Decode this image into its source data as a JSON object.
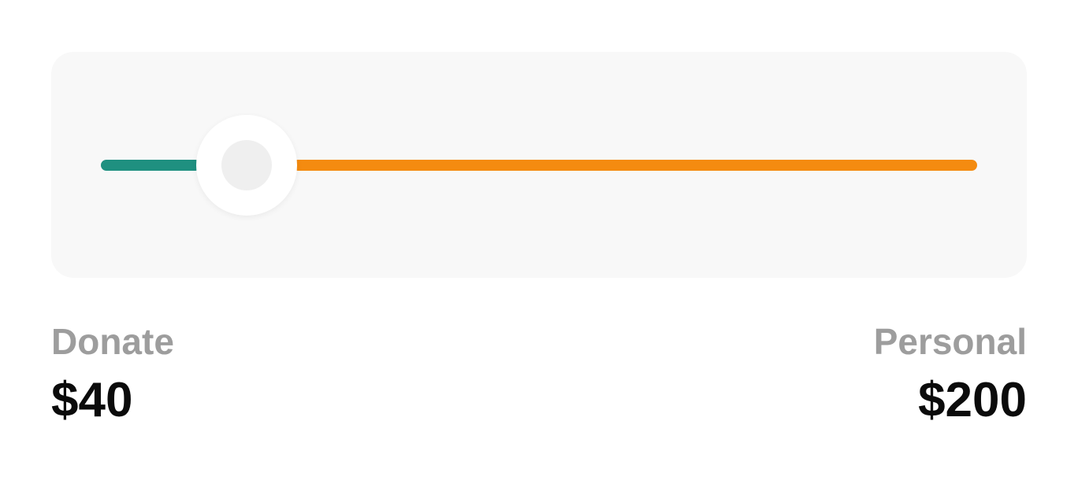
{
  "slider": {
    "value": 40,
    "min": 0,
    "max": 240,
    "left_color": "#1f9080",
    "right_color": "#f48b10"
  },
  "donate": {
    "label": "Donate",
    "amount": "$40"
  },
  "personal": {
    "label": "Personal",
    "amount": "$200"
  }
}
